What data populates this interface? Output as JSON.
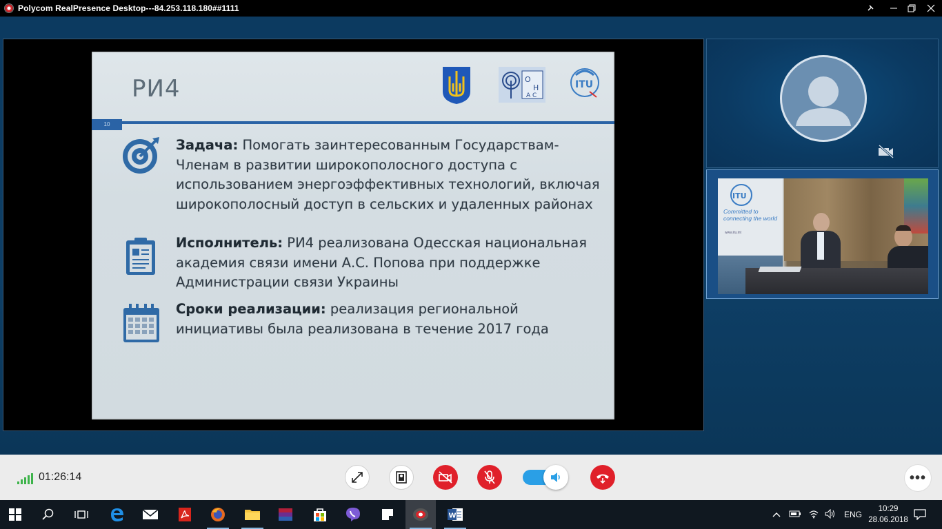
{
  "window": {
    "title": "Polycom RealPresence Desktop---84.253.118.180##1111",
    "controls": {
      "pin": "⊣",
      "minimize": "—",
      "maximize": "❐",
      "close": "✕"
    }
  },
  "slide": {
    "title": "РИ4",
    "page_number": "10",
    "rows": [
      {
        "label": "Задача:",
        "text": " Помогать заинтересованным Государствам-Членам в развитии широкополосного доступа с использованием энергоэффективных технологий, включая широкополосный доступ в сельских и удаленных районах",
        "icon": "target-icon"
      },
      {
        "label": "Исполнитель:",
        "text": " РИ4 реализована Одесская национальная академия связи имени А.С. Попова при поддержке Администрации связи Украины",
        "icon": "clipboard-icon"
      },
      {
        "label": "Сроки реализации:",
        "text": " реализация региональной инициативы была реализована в течение 2017 года",
        "icon": "calendar-icon"
      }
    ],
    "logos": [
      "ukraine-coat-of-arms",
      "onac-logo",
      "itu-logo"
    ]
  },
  "participants": {
    "local_avatar": "person-silhouette-icon",
    "camera_status": "camera-off-icon",
    "room_banner": {
      "logo_text": "ITU",
      "tagline": "Committed to connecting the world",
      "url": "www.itu.int"
    }
  },
  "call": {
    "duration": "01:26:14",
    "signal_bars": 5,
    "controls": [
      "fullscreen",
      "content-share",
      "camera-mute",
      "mic-mute",
      "speaker",
      "hang-up"
    ],
    "speaker_on": true,
    "more_label": "•••"
  },
  "colors": {
    "accent_red": "#e0202a",
    "toggle_blue": "#2a9fe6",
    "signal_green": "#3db34a",
    "slide_bar": "#2a63a6"
  },
  "taskbar": {
    "apps": [
      "windows-start",
      "search",
      "task-view",
      "edge",
      "mail",
      "pdf-reader",
      "firefox",
      "file-explorer",
      "winrar",
      "store",
      "viber",
      "sticky-notes",
      "polycom",
      "word"
    ],
    "tray": {
      "language": "ENG",
      "time": "10:29",
      "date": "28.06.2018"
    }
  }
}
